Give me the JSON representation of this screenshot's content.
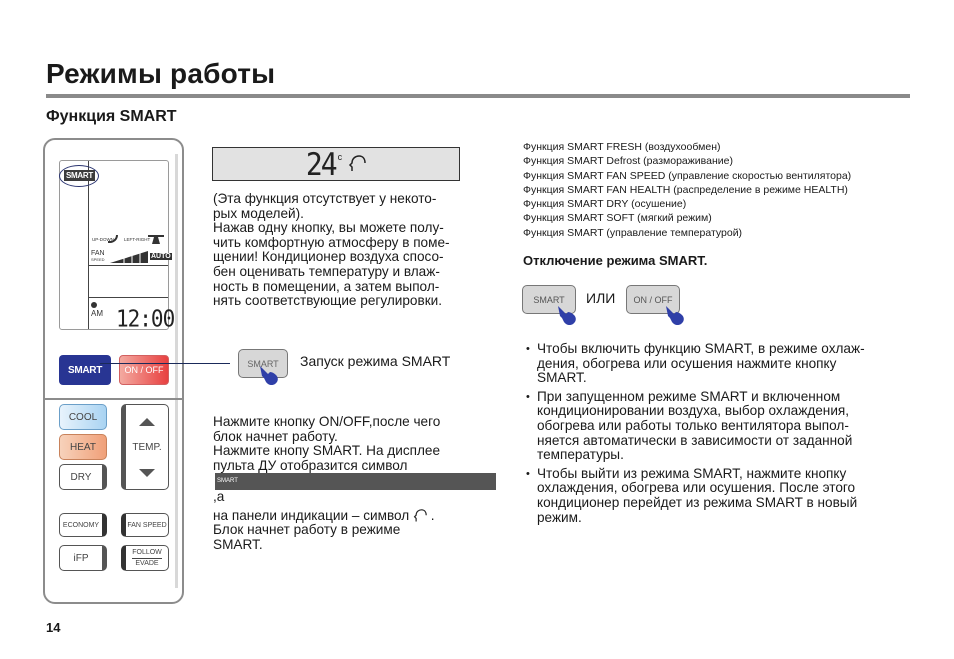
{
  "header": {
    "title": "Режимы работы",
    "section_title": "Функция SMART"
  },
  "remote": {
    "lcd": {
      "smart_badge": "SMART",
      "updown_label": "UP-DOWN",
      "leftright_label": "LEFT-RIGHT",
      "fan_label": "FAN",
      "fan_speed_label": "SPEED",
      "auto_label": "AUTO",
      "am_label": "AM",
      "clock": "12:00"
    },
    "buttons": {
      "smart": "SMART",
      "onoff": "ON / OFF",
      "cool": "COOL",
      "heat": "HEAT",
      "dry": "DRY",
      "temp": "TEMP.",
      "economy": "ECONOMY",
      "fan_speed": "FAN SPEED",
      "ifp": "iFP",
      "follow": "FOLLOW",
      "evade": "EVADE"
    }
  },
  "display_panel": {
    "temperature": "24",
    "unit": "c"
  },
  "intro": {
    "lines": [
      "(Эта функция отсутствует у некото-",
      "рых моделей).",
      "Нажав одну кнопку, вы можете полу-",
      "чить комфортную атмосферу в поме-",
      "щении! Кондиционер воздуха спосо-",
      "бен оценивать температуру и влаж-",
      "ность в помещении, а затем выпол-",
      "нять соответствующие регулировки."
    ]
  },
  "launch": {
    "button_label": "SMART",
    "label": "Запуск режима SMART"
  },
  "steps": {
    "line1": "Нажмите кнопку ON/OFF,после чего",
    "line2": "блок начнет работу.",
    "line3": "Нажмите кнопу SMART. На дисплее",
    "line4_prefix": "пульта ДУ отобразится символ",
    "line4_badge": "SMART",
    "line4_suffix": ",а",
    "line5_prefix": "на панели индикации – символ",
    "line5_suffix": ".",
    "line6": "Блок начнет работу в режиме",
    "line7": "SMART."
  },
  "functions": [
    "Функция SMART FRESH  (воздухообмен)",
    "Функция SMART Defrost (размораживание)",
    "Функция SMART FAN SPEED (управление скоростью вентилятора)",
    "Функция SMART FAN HEALTH  (распределение в режиме HEALTH)",
    "Функция SMART DRY (осушение)",
    "Функция SMART SOFT (мягкий режим)",
    "Функция SMART (управление температурой)"
  ],
  "disable": {
    "title": "Отключение режима SMART.",
    "smart_button": "SMART",
    "or_label": "ИЛИ",
    "onoff_button": "ON / OFF"
  },
  "bullets": [
    [
      "Чтобы включить функцию SMART, в режиме охлаж-",
      "дения, обогрева или осушения нажмите кнопку",
      "SMART."
    ],
    [
      "При запущенном режиме SMART и включенном",
      "кондиционировании воздуха, выбор охлаждения,",
      "обогрева или работы только вентилятора выпол-",
      "няется автоматически в зависимости от заданной",
      "температуры."
    ],
    [
      "Чтобы выйти из режима SMART, нажмите кнопку",
      "охлаждения, обогрева или осушения. После этого",
      "кондиционер перейдет из режима SMART в новый",
      "режим."
    ]
  ],
  "page_number": "14",
  "colors": {
    "smart_button": "#283593",
    "onoff_button": "#e84040",
    "cool_button": "#a9d3f2",
    "heat_button": "#f0a079",
    "hand": "#2f3fa8",
    "rule": "#8a8a8a"
  }
}
